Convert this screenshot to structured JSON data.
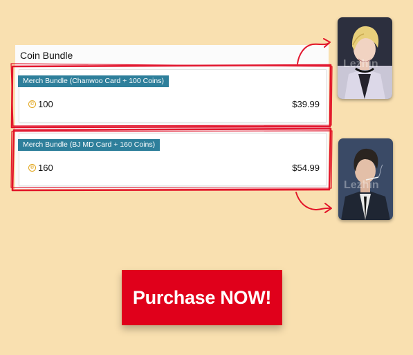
{
  "panel": {
    "title": "Coin Bundle"
  },
  "bundles": [
    {
      "tag": "Merch Bundle (Chanwoo Card + 100 Coins)",
      "coins": "100",
      "price": "$39.99"
    },
    {
      "tag": "Merch Bundle (BJ MD Card + 160 Coins)",
      "coins": "160",
      "price": "$54.99"
    }
  ],
  "coin_symbol": "©",
  "watermark": "Lezhin",
  "cta": {
    "label": "Purchase NOW!"
  },
  "colors": {
    "background": "#f9e0b0",
    "tag": "#2e7f9b",
    "highlight": "#e0001b",
    "coin": "#e1a51a"
  }
}
